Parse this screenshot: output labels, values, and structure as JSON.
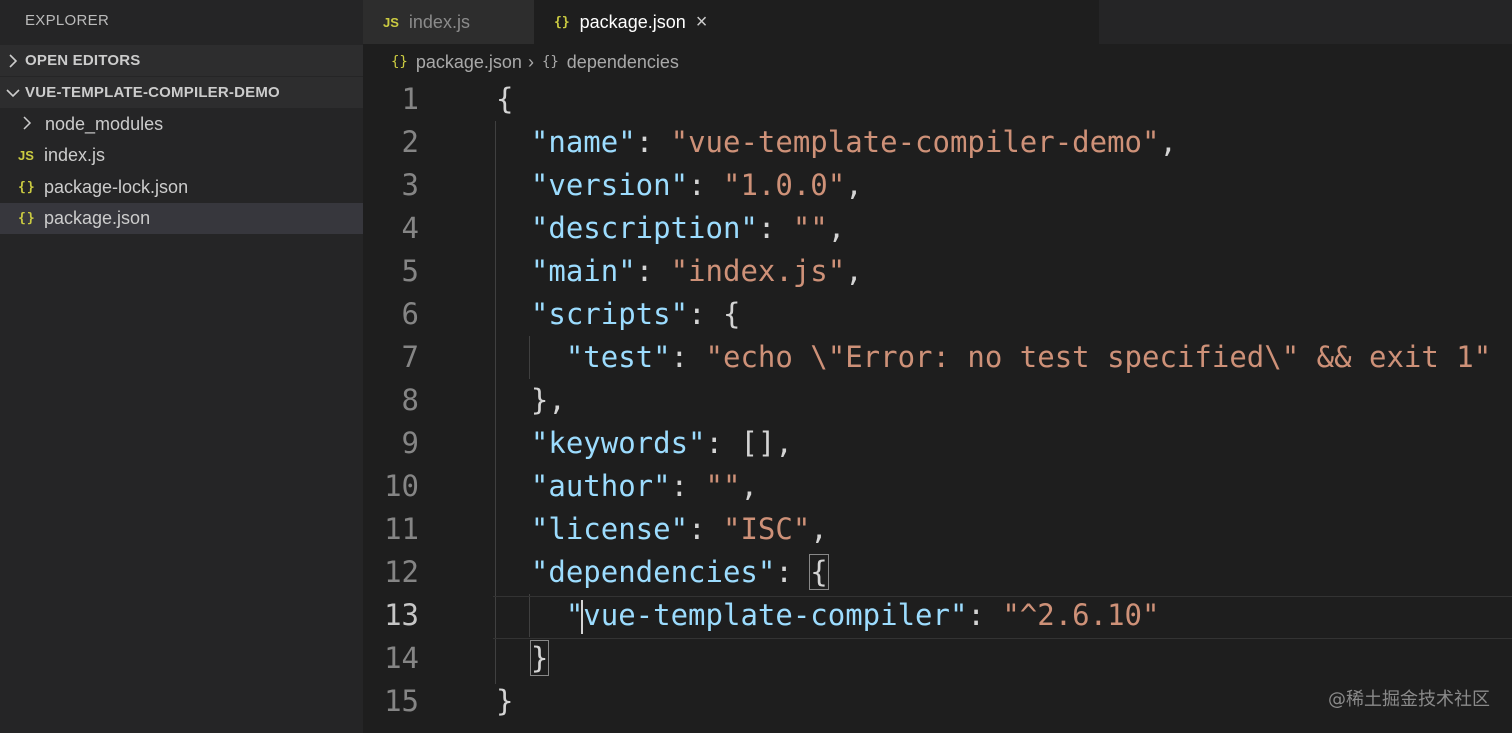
{
  "sidebar": {
    "title": "EXPLORER",
    "open_editors_label": "OPEN EDITORS",
    "project_label": "VUE-TEMPLATE-COMPILER-DEMO",
    "items": [
      {
        "icon": "",
        "label": "node_modules"
      },
      {
        "icon": "JS",
        "label": "index.js"
      },
      {
        "icon": "{}",
        "label": "package-lock.json"
      },
      {
        "icon": "{}",
        "label": "package.json"
      }
    ]
  },
  "tabs": [
    {
      "icon": "JS",
      "label": "index.js"
    },
    {
      "icon": "{}",
      "label": "package.json",
      "close": "×"
    }
  ],
  "breadcrumb": {
    "icon1": "{}",
    "file": "package.json",
    "separator": "›",
    "icon2": "{}",
    "symbol": "dependencies"
  },
  "editor": {
    "line_numbers": [
      "1",
      "2",
      "3",
      "4",
      "5",
      "6",
      "7",
      "8",
      "9",
      "10",
      "11",
      "12",
      "13",
      "14",
      "15"
    ],
    "lines": [
      [
        {
          "t": "p",
          "v": "{"
        }
      ],
      [
        {
          "t": "p",
          "v": "  "
        },
        {
          "t": "k",
          "v": "\"name\""
        },
        {
          "t": "p",
          "v": ": "
        },
        {
          "t": "s",
          "v": "\"vue-template-compiler-demo\""
        },
        {
          "t": "p",
          "v": ","
        }
      ],
      [
        {
          "t": "p",
          "v": "  "
        },
        {
          "t": "k",
          "v": "\"version\""
        },
        {
          "t": "p",
          "v": ": "
        },
        {
          "t": "s",
          "v": "\"1.0.0\""
        },
        {
          "t": "p",
          "v": ","
        }
      ],
      [
        {
          "t": "p",
          "v": "  "
        },
        {
          "t": "k",
          "v": "\"description\""
        },
        {
          "t": "p",
          "v": ": "
        },
        {
          "t": "s",
          "v": "\"\""
        },
        {
          "t": "p",
          "v": ","
        }
      ],
      [
        {
          "t": "p",
          "v": "  "
        },
        {
          "t": "k",
          "v": "\"main\""
        },
        {
          "t": "p",
          "v": ": "
        },
        {
          "t": "s",
          "v": "\"index.js\""
        },
        {
          "t": "p",
          "v": ","
        }
      ],
      [
        {
          "t": "p",
          "v": "  "
        },
        {
          "t": "k",
          "v": "\"scripts\""
        },
        {
          "t": "p",
          "v": ": {"
        }
      ],
      [
        {
          "t": "p",
          "v": "    "
        },
        {
          "t": "k",
          "v": "\"test\""
        },
        {
          "t": "p",
          "v": ": "
        },
        {
          "t": "s",
          "v": "\"echo \\\"Error: no test specified\\\" && exit 1\""
        }
      ],
      [
        {
          "t": "p",
          "v": "  },"
        }
      ],
      [
        {
          "t": "p",
          "v": "  "
        },
        {
          "t": "k",
          "v": "\"keywords\""
        },
        {
          "t": "p",
          "v": ": [],"
        }
      ],
      [
        {
          "t": "p",
          "v": "  "
        },
        {
          "t": "k",
          "v": "\"author\""
        },
        {
          "t": "p",
          "v": ": "
        },
        {
          "t": "s",
          "v": "\"\""
        },
        {
          "t": "p",
          "v": ","
        }
      ],
      [
        {
          "t": "p",
          "v": "  "
        },
        {
          "t": "k",
          "v": "\"license\""
        },
        {
          "t": "p",
          "v": ": "
        },
        {
          "t": "s",
          "v": "\"ISC\""
        },
        {
          "t": "p",
          "v": ","
        }
      ],
      [
        {
          "t": "p",
          "v": "  "
        },
        {
          "t": "k",
          "v": "\"dependencies\""
        },
        {
          "t": "p",
          "v": ": "
        },
        {
          "t": "p",
          "v": "{",
          "m": 1
        }
      ],
      [
        {
          "t": "p",
          "v": "    "
        },
        {
          "t": "k",
          "v": "\"vue-template-compiler\""
        },
        {
          "t": "p",
          "v": ": "
        },
        {
          "t": "s",
          "v": "\"^2.6.10\""
        }
      ],
      [
        {
          "t": "p",
          "v": "  "
        },
        {
          "t": "p",
          "v": "}",
          "m": 1
        }
      ],
      [
        {
          "t": "p",
          "v": "}"
        }
      ]
    ]
  },
  "watermark": "@稀土掘金技术社区"
}
